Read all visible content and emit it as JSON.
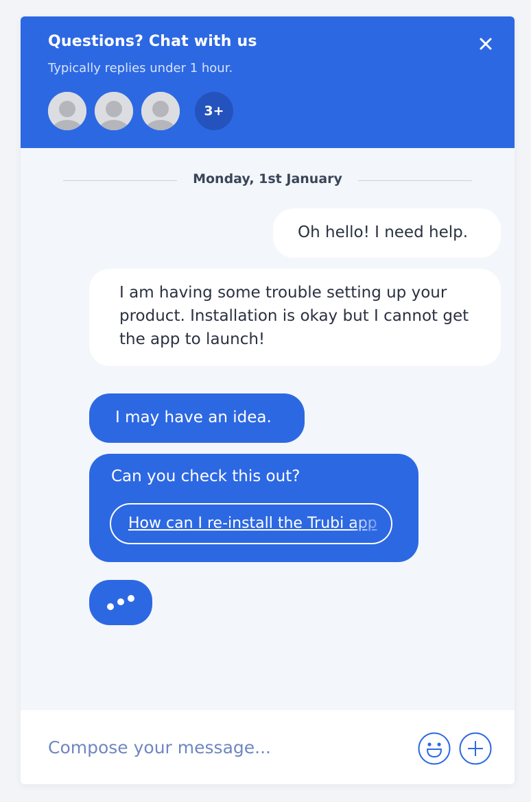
{
  "header": {
    "title": "Questions? Chat with us",
    "subtitle": "Typically replies under 1 hour.",
    "more_count": "3+",
    "close_icon": "close-icon"
  },
  "colors": {
    "brand": "#2d68e3",
    "brand_dark": "#2453bd",
    "background": "#f3f6fa",
    "user_bubble": "#ffffff",
    "text": "#2a3140"
  },
  "conversation": {
    "date": "Monday, 1st January",
    "messages": [
      {
        "sender": "user",
        "text": "Oh hello! I need help."
      },
      {
        "sender": "user",
        "text": "I am having some trouble setting up your product. Installation is okay but I cannot get the app to launch!"
      },
      {
        "sender": "agent",
        "text": "I may have an idea."
      },
      {
        "sender": "agent",
        "text": "Can you check this out?",
        "link": "How can I re-install the Trubi app"
      }
    ],
    "typing_indicator": "agent-typing"
  },
  "composer": {
    "placeholder": "Compose your message...",
    "emoji_icon": "smiley-icon",
    "attach_icon": "plus-icon"
  }
}
